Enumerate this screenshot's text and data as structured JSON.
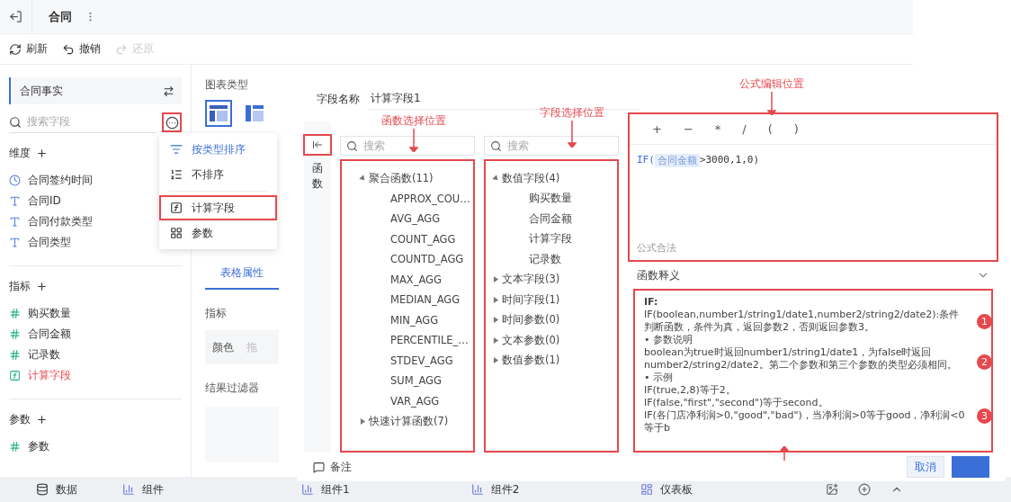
{
  "top_bar": {
    "tab": "合同"
  },
  "toolbar": [
    {
      "label": "刷新",
      "kind": "refresh",
      "disabled": false
    },
    {
      "label": "撤销",
      "kind": "undo",
      "disabled": false
    },
    {
      "label": "还原",
      "kind": "redo",
      "disabled": true
    }
  ],
  "data_panel": {
    "dataset": "合同事实",
    "search": {
      "placeholder": "搜索字段"
    },
    "more_button": {
      "highlighted": true
    },
    "sections": [
      {
        "title": "维度",
        "items": [
          {
            "label": "合同签约时间",
            "kind": "time"
          },
          {
            "label": "合同ID",
            "kind": "text"
          },
          {
            "label": "合同付款类型",
            "kind": "text"
          },
          {
            "label": "合同类型",
            "kind": "text"
          }
        ]
      },
      {
        "title": "指标",
        "items": [
          {
            "label": "购买数量",
            "kind": "number"
          },
          {
            "label": "合同金额",
            "kind": "number"
          },
          {
            "label": "记录数",
            "kind": "record"
          },
          {
            "label": "计算字段",
            "kind": "calc"
          }
        ]
      },
      {
        "title": "参数",
        "items": [
          {
            "label": "参数",
            "kind": "number"
          }
        ]
      }
    ]
  },
  "sort_menu": {
    "items": [
      {
        "label": "按类型排序",
        "kind": "sort-type",
        "selected": true,
        "highlighted": false
      },
      {
        "label": "不排序",
        "kind": "no-sort",
        "selected": false,
        "highlighted": false
      },
      {
        "label": "计算字段",
        "kind": "calc",
        "selected": false,
        "highlighted": true
      },
      {
        "label": "参数",
        "kind": "param",
        "selected": false,
        "highlighted": false
      }
    ]
  },
  "chart_panel": {
    "title": "图表类型",
    "chart_types": [
      {
        "kind": "table",
        "selected": true
      },
      {
        "kind": "cross-table",
        "selected": false
      }
    ],
    "tabs": [
      {
        "label": "表格属性",
        "selected": true
      }
    ],
    "metric_title": "指标",
    "color_label": "颜色",
    "drop_hint": "拖",
    "filter_title": "结果过滤器"
  },
  "bottom_bar": {
    "panel_tabs": [
      {
        "label": "数据",
        "kind": "data"
      },
      {
        "label": "组件",
        "kind": "chart"
      }
    ],
    "canvas_tabs": [
      {
        "label": "组件1",
        "kind": "chart"
      },
      {
        "label": "组件2",
        "kind": "chart"
      },
      {
        "label": "仪表板",
        "kind": "dashboard"
      }
    ]
  },
  "dialog": {
    "field_name": {
      "label": "字段名称",
      "value": "计算字段1"
    },
    "side_tab": {
      "label": "函数",
      "highlighted": true
    },
    "functions": {
      "placeholder": "搜索",
      "highlighted": true,
      "groups": [
        {
          "label": "聚合函数(11)",
          "expanded": true,
          "children": [
            {
              "label": "APPROX_COU…"
            },
            {
              "label": "AVG_AGG"
            },
            {
              "label": "COUNT_AGG"
            },
            {
              "label": "COUNTD_AGG"
            },
            {
              "label": "MAX_AGG"
            },
            {
              "label": "MEDIAN_AGG"
            },
            {
              "label": "MIN_AGG"
            },
            {
              "label": "PERCENTILE_…"
            },
            {
              "label": "STDEV_AGG"
            },
            {
              "label": "SUM_AGG"
            },
            {
              "label": "VAR_AGG"
            }
          ]
        },
        {
          "label": "快速计算函数(7)",
          "expanded": false
        }
      ]
    },
    "fields": {
      "placeholder": "搜索",
      "highlighted": true,
      "groups": [
        {
          "label": "数值字段(4)",
          "expanded": true,
          "children": [
            {
              "label": "购买数量"
            },
            {
              "label": "合同金额"
            },
            {
              "label": "计算字段"
            },
            {
              "label": "记录数"
            }
          ]
        },
        {
          "label": "文本字段(3)",
          "expanded": false
        },
        {
          "label": "时间字段(1)",
          "expanded": false
        },
        {
          "label": "时间参数(0)",
          "expanded": false
        },
        {
          "label": "文本参数(0)",
          "expanded": false
        },
        {
          "label": "数值参数(1)",
          "expanded": false
        }
      ]
    },
    "editor": {
      "highlighted": true,
      "operators": [
        "+",
        "−",
        "*",
        "/",
        "(",
        ")"
      ],
      "formula": [
        {
          "kind": "function",
          "text": "IF("
        },
        {
          "kind": "field",
          "text": "合同金额"
        },
        {
          "kind": "literal",
          "text": ">3000,1,0)"
        }
      ],
      "status": "公式合法"
    },
    "doc": {
      "title": "函数释义",
      "expanded": true,
      "highlighted": true,
      "lines": [
        {
          "kind": "title",
          "text": "IF:"
        },
        {
          "kind": "text",
          "text": "IF(boolean,number1/string1/date1,number2/string2/date2):条件判断函数，条件为真，返回参数2，否则返回参数3。"
        },
        {
          "kind": "bullet",
          "text": "• 参数说明"
        },
        {
          "kind": "text",
          "text": "boolean为true时返回number1/string1/date1，为false时返回number2/string2/date2。第二个参数和第三个参数的类型必须相同。"
        },
        {
          "kind": "bullet",
          "text": "• 示例"
        },
        {
          "kind": "text",
          "text": "IF(true,2,8)等于2。"
        },
        {
          "kind": "text",
          "text": "IF(false,\"first\",\"second\")等于second。"
        },
        {
          "kind": "text",
          "text": "IF(各门店净利润>0,\"good\",\"bad\")，当净利润>0等于good，净利润<0等于b"
        }
      ]
    },
    "note": "备注",
    "buttons": [
      {
        "label": "取消",
        "kind": "secondary"
      },
      {
        "kind": "primary"
      }
    ]
  },
  "annotations": [
    {
      "kind": "label",
      "text": "函数选择位置"
    },
    {
      "kind": "label",
      "text": "字段选择位置"
    },
    {
      "kind": "label",
      "text": "公式编辑位置"
    },
    {
      "kind": "marker",
      "text": "1"
    },
    {
      "kind": "marker",
      "text": "2"
    },
    {
      "kind": "marker",
      "text": "3"
    },
    {
      "kind": "arrow-up"
    }
  ]
}
